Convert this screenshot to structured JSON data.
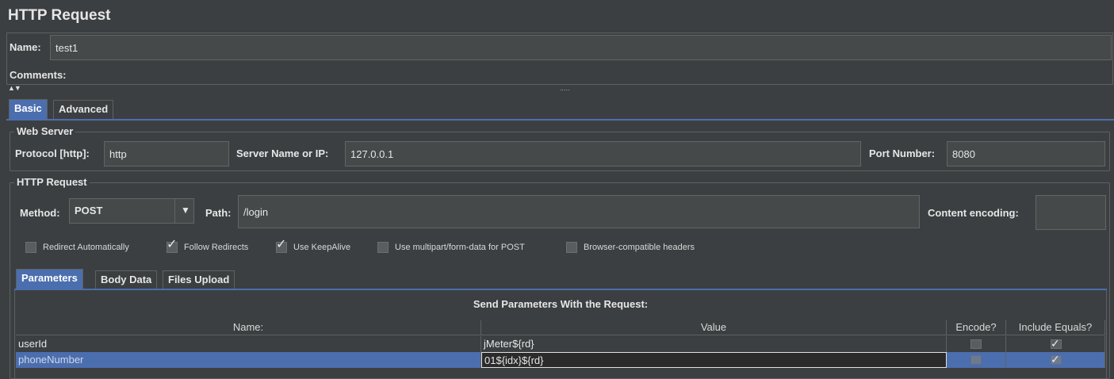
{
  "panel": {
    "title": "HTTP Request"
  },
  "name_field": {
    "label": "Name:",
    "value": "test1"
  },
  "comments": {
    "label": "Comments:"
  },
  "splitter": {
    "arrows": "▲▼",
    "grip": "....."
  },
  "main_tabs": [
    {
      "label": "Basic"
    },
    {
      "label": "Advanced"
    }
  ],
  "web_server": {
    "title": "Web Server",
    "protocol_label": "Protocol [http]:",
    "protocol_value": "http",
    "server_label": "Server Name or IP:",
    "server_value": "127.0.0.1",
    "port_label": "Port Number:",
    "port_value": "8080"
  },
  "http_request": {
    "title": "HTTP Request",
    "method_label": "Method:",
    "method_value": "POST",
    "path_label": "Path:",
    "path_value": "/login",
    "encoding_label": "Content encoding:",
    "encoding_value": ""
  },
  "options": [
    {
      "label": "Redirect Automatically",
      "checked": false
    },
    {
      "label": "Follow Redirects",
      "checked": true
    },
    {
      "label": "Use KeepAlive",
      "checked": true
    },
    {
      "label": "Use multipart/form-data for POST",
      "checked": false
    },
    {
      "label": "Browser-compatible headers",
      "checked": false
    }
  ],
  "sub_tabs": [
    {
      "label": "Parameters"
    },
    {
      "label": "Body Data"
    },
    {
      "label": "Files Upload"
    }
  ],
  "params": {
    "caption": "Send Parameters With the Request:",
    "columns": [
      "Name:",
      "Value",
      "Encode?",
      "Include Equals?"
    ],
    "rows": [
      {
        "name": "userId",
        "value": "jMeter${rd}",
        "encode": false,
        "include_equals": true,
        "selected": false
      },
      {
        "name": "phoneNumber",
        "value": "01${idx}${rd}",
        "encode": false,
        "include_equals": true,
        "selected": true
      }
    ]
  },
  "colors": {
    "background": "#3c3f41",
    "selection": "#4b6eaf",
    "field": "#45494a"
  },
  "icons": {
    "dropdown": "dropdown-arrow-icon",
    "check": "checkmark-icon"
  }
}
